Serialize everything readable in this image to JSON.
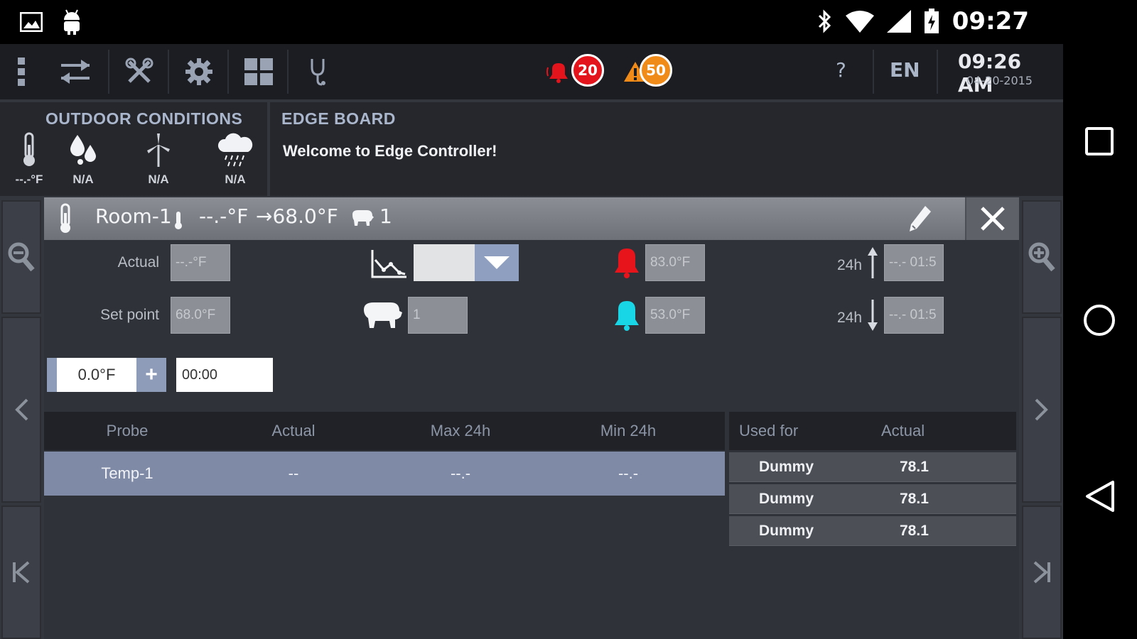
{
  "status_bar": {
    "time": "09:27",
    "icons": [
      "image-icon",
      "android-icon",
      "bluetooth-icon",
      "wifi-icon",
      "signal-icon",
      "battery-icon"
    ]
  },
  "toolbar": {
    "alarm_count": "20",
    "warning_count": "50",
    "help_label": "?",
    "language": "EN",
    "clock_time": "09:26 AM",
    "clock_date": "04-20-2015",
    "colors": {
      "alarm": "#e3141b",
      "warning": "#f08a18",
      "background": "#1b1d22"
    }
  },
  "outdoor": {
    "title": "OUTDOOR CONDITIONS",
    "temperature": "--.-°F",
    "humidity": "N/A",
    "wind": "N/A",
    "rain": "N/A"
  },
  "edge_board": {
    "title": "EDGE BOARD",
    "message": "Welcome to Edge Controller!"
  },
  "room": {
    "name": "Room-1",
    "current_temp": "--.-°F",
    "target_temp": "→68.0°F",
    "animal_count": "1",
    "actual_label": "Actual",
    "actual_value": "--.-°F",
    "setpoint_label": "Set point",
    "setpoint_value": "68.0°F",
    "animals_value": "1",
    "alarm_high_value": "83.0°F",
    "alarm_low_value": "53.0°F",
    "max24_label": "24h",
    "max24_value": "--.- 01:5",
    "min24_label": "24h",
    "min24_value": "--.- 01:5",
    "offset_value": "0.0°F",
    "offset_plus": "+",
    "time_value": "00:00",
    "colors": {
      "alarm_high": "#e8141c",
      "alarm_low": "#19d6e6",
      "selected_row": "#7f8aa6"
    }
  },
  "probe_table": {
    "headers": [
      "Probe",
      "Actual",
      "Max 24h",
      "Min 24h"
    ],
    "rows": [
      {
        "probe": "Temp-1",
        "actual": "--",
        "max": "--.-",
        "min": "--.-"
      }
    ]
  },
  "used_for_table": {
    "headers": [
      "Used for",
      "Actual"
    ],
    "rows": [
      {
        "used_for": "Dummy",
        "actual": "78.1"
      },
      {
        "used_for": "Dummy",
        "actual": "78.1"
      },
      {
        "used_for": "Dummy",
        "actual": "78.1"
      }
    ]
  }
}
